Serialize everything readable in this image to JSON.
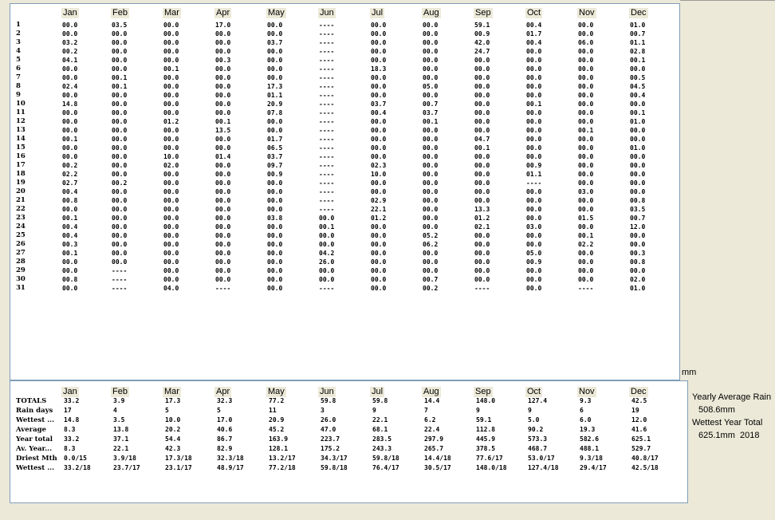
{
  "months": [
    "Jan",
    "Feb",
    "Mar",
    "Apr",
    "May",
    "Jun",
    "Jul",
    "Aug",
    "Sep",
    "Oct",
    "Nov",
    "Dec"
  ],
  "days": [
    "1",
    "2",
    "3",
    "4",
    "5",
    "6",
    "7",
    "8",
    "9",
    "10",
    "11",
    "12",
    "13",
    "14",
    "15",
    "16",
    "17",
    "18",
    "19",
    "20",
    "21",
    "22",
    "23",
    "24",
    "25",
    "26",
    "27",
    "28",
    "29",
    "30",
    "31"
  ],
  "daily": [
    [
      "00.0",
      "03.5",
      "00.0",
      "17.0",
      "00.0",
      "----",
      "00.0",
      "00.0",
      "59.1",
      "00.4",
      "00.0",
      "01.0"
    ],
    [
      "00.0",
      "00.0",
      "00.0",
      "00.0",
      "00.0",
      "----",
      "00.0",
      "00.0",
      "00.9",
      "01.7",
      "00.0",
      "00.7"
    ],
    [
      "03.2",
      "00.0",
      "00.0",
      "00.0",
      "03.7",
      "----",
      "00.0",
      "00.0",
      "42.0",
      "00.4",
      "06.0",
      "01.1"
    ],
    [
      "00.2",
      "00.0",
      "00.0",
      "00.0",
      "00.0",
      "----",
      "00.0",
      "00.0",
      "24.7",
      "00.0",
      "00.0",
      "02.8"
    ],
    [
      "04.1",
      "00.0",
      "00.0",
      "00.3",
      "00.0",
      "----",
      "00.0",
      "00.0",
      "00.0",
      "00.0",
      "00.0",
      "00.1"
    ],
    [
      "00.0",
      "00.0",
      "00.1",
      "00.0",
      "00.0",
      "----",
      "18.3",
      "00.0",
      "00.0",
      "00.0",
      "00.0",
      "00.0"
    ],
    [
      "00.0",
      "00.1",
      "00.0",
      "00.0",
      "00.0",
      "----",
      "00.0",
      "00.0",
      "00.0",
      "00.0",
      "00.0",
      "00.5"
    ],
    [
      "02.4",
      "00.1",
      "00.0",
      "00.0",
      "17.3",
      "----",
      "00.0",
      "05.0",
      "00.0",
      "00.0",
      "00.0",
      "04.5"
    ],
    [
      "00.0",
      "00.0",
      "00.0",
      "00.0",
      "01.1",
      "----",
      "00.0",
      "00.0",
      "00.0",
      "00.0",
      "00.0",
      "00.4"
    ],
    [
      "14.8",
      "00.0",
      "00.0",
      "00.0",
      "20.9",
      "----",
      "03.7",
      "00.7",
      "00.0",
      "00.1",
      "00.0",
      "00.0"
    ],
    [
      "00.0",
      "00.0",
      "00.0",
      "00.0",
      "07.8",
      "----",
      "00.4",
      "03.7",
      "00.0",
      "00.0",
      "00.0",
      "00.1"
    ],
    [
      "00.0",
      "00.0",
      "01.2",
      "00.1",
      "00.0",
      "----",
      "00.0",
      "00.1",
      "00.0",
      "00.0",
      "00.0",
      "01.0"
    ],
    [
      "00.0",
      "00.0",
      "00.0",
      "13.5",
      "00.0",
      "----",
      "00.0",
      "00.0",
      "00.0",
      "00.0",
      "00.1",
      "00.0"
    ],
    [
      "00.1",
      "00.0",
      "00.0",
      "00.0",
      "01.7",
      "----",
      "00.0",
      "00.0",
      "04.7",
      "00.0",
      "00.0",
      "00.0"
    ],
    [
      "00.0",
      "00.0",
      "00.0",
      "00.0",
      "06.5",
      "----",
      "00.0",
      "00.0",
      "00.1",
      "00.0",
      "00.0",
      "01.0"
    ],
    [
      "00.0",
      "00.0",
      "10.0",
      "01.4",
      "03.7",
      "----",
      "00.0",
      "00.0",
      "00.0",
      "00.0",
      "00.0",
      "00.0"
    ],
    [
      "00.2",
      "00.0",
      "02.0",
      "00.0",
      "09.7",
      "----",
      "02.3",
      "00.0",
      "00.0",
      "00.9",
      "00.0",
      "00.0"
    ],
    [
      "02.2",
      "00.0",
      "00.0",
      "00.0",
      "00.9",
      "----",
      "10.0",
      "00.0",
      "00.0",
      "01.1",
      "00.0",
      "00.0"
    ],
    [
      "02.7",
      "00.2",
      "00.0",
      "00.0",
      "00.0",
      "----",
      "00.0",
      "00.0",
      "00.0",
      "----",
      "00.0",
      "00.0"
    ],
    [
      "00.4",
      "00.0",
      "00.0",
      "00.0",
      "00.0",
      "----",
      "00.0",
      "00.0",
      "00.0",
      "00.0",
      "03.0",
      "00.0"
    ],
    [
      "00.8",
      "00.0",
      "00.0",
      "00.0",
      "00.0",
      "----",
      "02.9",
      "00.0",
      "00.0",
      "00.0",
      "00.0",
      "00.8"
    ],
    [
      "00.0",
      "00.0",
      "00.0",
      "00.0",
      "00.0",
      "----",
      "22.1",
      "00.0",
      "13.3",
      "00.0",
      "00.0",
      "03.5"
    ],
    [
      "00.1",
      "00.0",
      "00.0",
      "00.0",
      "03.8",
      "00.0",
      "01.2",
      "00.0",
      "01.2",
      "00.0",
      "01.5",
      "00.7"
    ],
    [
      "00.4",
      "00.0",
      "00.0",
      "00.0",
      "00.0",
      "00.1",
      "00.0",
      "00.0",
      "02.1",
      "03.0",
      "00.0",
      "12.0"
    ],
    [
      "00.4",
      "00.0",
      "00.0",
      "00.0",
      "00.0",
      "00.0",
      "00.0",
      "05.2",
      "00.0",
      "00.0",
      "00.1",
      "00.0"
    ],
    [
      "00.3",
      "00.0",
      "00.0",
      "00.0",
      "00.0",
      "00.0",
      "00.0",
      "06.2",
      "00.0",
      "00.0",
      "02.2",
      "00.0"
    ],
    [
      "00.1",
      "00.0",
      "00.0",
      "00.0",
      "00.0",
      "04.2",
      "00.0",
      "00.0",
      "00.0",
      "05.0",
      "00.0",
      "00.3"
    ],
    [
      "00.0",
      "00.0",
      "00.0",
      "00.0",
      "00.0",
      "26.0",
      "00.0",
      "00.0",
      "00.0",
      "00.9",
      "00.0",
      "00.8"
    ],
    [
      "00.0",
      "----",
      "00.0",
      "00.0",
      "00.0",
      "00.0",
      "00.0",
      "00.0",
      "00.0",
      "00.0",
      "00.0",
      "00.0"
    ],
    [
      "00.8",
      "----",
      "00.0",
      "00.0",
      "00.0",
      "00.0",
      "00.0",
      "00.7",
      "00.0",
      "00.0",
      "00.0",
      "02.0"
    ],
    [
      "00.0",
      "----",
      "04.0",
      "----",
      "00.0",
      "----",
      "00.0",
      "00.2",
      "----",
      "00.0",
      "----",
      "01.0"
    ]
  ],
  "unit_label": "mm",
  "summary": [
    {
      "label": "TOTALS",
      "values": [
        "33.2",
        "3.9",
        "17.3",
        "32.3",
        "77.2",
        "59.8",
        "59.8",
        "14.4",
        "148.0",
        "127.4",
        "9.3",
        "42.5"
      ]
    },
    {
      "label": "Rain days",
      "values": [
        "17",
        "4",
        "5",
        "5",
        "11",
        "3",
        "9",
        "7",
        "9",
        "9",
        "6",
        "19"
      ]
    },
    {
      "label": "Wettest ...",
      "values": [
        "14.8",
        "3.5",
        "10.0",
        "17.0",
        "20.9",
        "26.0",
        "22.1",
        "6.2",
        "59.1",
        "5.0",
        "6.0",
        "12.0"
      ]
    },
    {
      "label": "Average",
      "values": [
        "8.3",
        "13.8",
        "20.2",
        "40.6",
        "45.2",
        "47.0",
        "68.1",
        "22.4",
        "112.8",
        "90.2",
        "19.3",
        "41.6"
      ]
    },
    {
      "label": "Year total",
      "values": [
        "33.2",
        "37.1",
        "54.4",
        "86.7",
        "163.9",
        "223.7",
        "283.5",
        "297.9",
        "445.9",
        "573.3",
        "582.6",
        "625.1"
      ]
    },
    {
      "label": "Av. Year...",
      "values": [
        "8.3",
        "22.1",
        "42.3",
        "82.9",
        "128.1",
        "175.2",
        "243.3",
        "265.7",
        "378.5",
        "468.7",
        "488.1",
        "529.7"
      ]
    },
    {
      "label": "Driest Mth",
      "values": [
        "0.0/15",
        "3.9/18",
        "17.3/18",
        "32.3/18",
        "13.2/17",
        "34.3/17",
        "59.8/18",
        "14.4/18",
        "77.6/17",
        "53.0/17",
        "9.3/18",
        "40.8/17"
      ]
    },
    {
      "label": "Wettest ...",
      "values": [
        "33.2/18",
        "23.7/17",
        "23.1/17",
        "48.9/17",
        "77.2/18",
        "59.8/18",
        "76.4/17",
        "30.5/17",
        "148.0/18",
        "127.4/18",
        "29.4/17",
        "42.5/18"
      ]
    }
  ],
  "side": {
    "yearly_average_label": "Yearly Average Rain",
    "yearly_average_value": "508.6mm",
    "wettest_year_label": "Wettest Year Total",
    "wettest_year_value": "625.1mm",
    "wettest_year_year": "2018"
  }
}
